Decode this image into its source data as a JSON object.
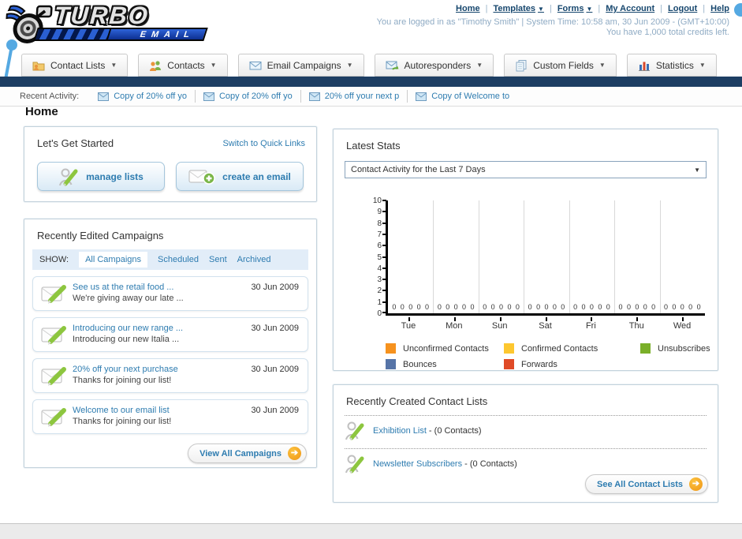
{
  "header": {
    "logo_title": "TURBO",
    "logo_subtitle": "EMAIL",
    "nav_links": [
      {
        "label": "Home",
        "dropdown": false
      },
      {
        "label": "Templates",
        "dropdown": true
      },
      {
        "label": "Forms",
        "dropdown": true
      },
      {
        "label": "My Account",
        "dropdown": false
      },
      {
        "label": "Logout",
        "dropdown": false
      },
      {
        "label": "Help",
        "dropdown": false
      }
    ],
    "login_info": "You are logged in as \"Timothy Smith\" | System Time: 10:58 am, 30 Jun 2009 - (GMT+10:00)",
    "credits_info": "You have 1,000 total credits left."
  },
  "tabs": [
    {
      "label": "Contact Lists",
      "icon": "folder-contact-icon"
    },
    {
      "label": "Contacts",
      "icon": "contacts-icon"
    },
    {
      "label": "Email Campaigns",
      "icon": "envelope-icon"
    },
    {
      "label": "Autoresponders",
      "icon": "envelope-arrow-icon"
    },
    {
      "label": "Custom Fields",
      "icon": "pages-icon"
    },
    {
      "label": "Statistics",
      "icon": "bar-chart-icon"
    }
  ],
  "recent_activity": {
    "label": "Recent Activity:",
    "items": [
      {
        "text": "Copy of 20% off yo"
      },
      {
        "text": "Copy of 20% off yo"
      },
      {
        "text": "20% off your next p"
      },
      {
        "text": "Copy of Welcome to"
      }
    ]
  },
  "page_title": "Home",
  "get_started": {
    "title": "Let's Get Started",
    "switch_link": "Switch to Quick Links",
    "manage_lists_label": "manage lists",
    "create_email_label": "create an email"
  },
  "campaigns": {
    "title": "Recently Edited Campaigns",
    "show_label": "SHOW:",
    "filters": [
      {
        "label": "All Campaigns",
        "active": true
      },
      {
        "label": "Scheduled",
        "active": false
      },
      {
        "label": "Sent",
        "active": false
      },
      {
        "label": "Archived",
        "active": false
      }
    ],
    "items": [
      {
        "title": "See us at the retail food ...",
        "subtitle": "We're giving away our late ...",
        "date": "30 Jun 2009"
      },
      {
        "title": "Introducing our new range ...",
        "subtitle": "Introducing our new Italia ...",
        "date": "30 Jun 2009"
      },
      {
        "title": "20% off your next purchase",
        "subtitle": "Thanks for joining our list!",
        "date": "30 Jun 2009"
      },
      {
        "title": "Welcome to our email list",
        "subtitle": "Thanks for joining our list!",
        "date": "30 Jun 2009"
      }
    ],
    "view_all_label": "View All Campaigns"
  },
  "stats": {
    "title": "Latest Stats",
    "dropdown_value": "Contact Activity for the Last 7 Days"
  },
  "chart_data": {
    "type": "bar",
    "title": "Contact Activity for the Last 7 Days",
    "categories": [
      "Tue",
      "Mon",
      "Sun",
      "Sat",
      "Fri",
      "Thu",
      "Wed"
    ],
    "series": [
      {
        "name": "Unconfirmed Contacts",
        "color": "#f6921e",
        "values": [
          0,
          0,
          0,
          0,
          0,
          0,
          0
        ]
      },
      {
        "name": "Confirmed Contacts",
        "color": "#fdc72f",
        "values": [
          0,
          0,
          0,
          0,
          0,
          0,
          0
        ]
      },
      {
        "name": "Unsubscribes",
        "color": "#7aaf29",
        "values": [
          0,
          0,
          0,
          0,
          0,
          0,
          0
        ]
      },
      {
        "name": "Bounces",
        "color": "#5674a7",
        "values": [
          0,
          0,
          0,
          0,
          0,
          0,
          0
        ]
      },
      {
        "name": "Forwards",
        "color": "#e04a26",
        "values": [
          0,
          0,
          0,
          0,
          0,
          0,
          0
        ]
      }
    ],
    "ylim": [
      0,
      10
    ],
    "yticks": [
      0,
      1,
      2,
      3,
      4,
      5,
      6,
      7,
      8,
      9,
      10
    ],
    "value_labels_shown": true,
    "grid": "vertical",
    "legend_position": "bottom"
  },
  "contact_lists": {
    "title": "Recently Created Contact Lists",
    "items": [
      {
        "name": "Exhibition List",
        "suffix": " - (0 Contacts)"
      },
      {
        "name": "Newsletter Subscribers",
        "suffix": " - (0 Contacts)"
      }
    ],
    "see_all_label": "See All Contact Lists"
  },
  "colors": {
    "navy_bar": "#1d3e63",
    "link_teal": "#2e7cb0",
    "header_link": "#17476e",
    "accent_orange": "#f2a21b",
    "decor_blue": "#55a9e2",
    "show_bar_bg": "#e2edf8"
  }
}
